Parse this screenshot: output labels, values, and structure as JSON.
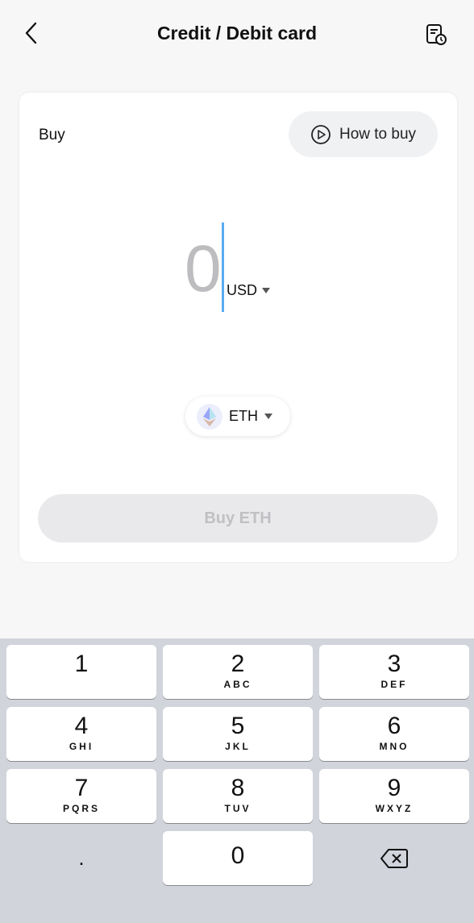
{
  "header": {
    "title": "Credit / Debit card",
    "back_icon": "chevron-left-icon",
    "history_icon": "order-history-icon"
  },
  "card": {
    "buy_label": "Buy",
    "how_to_buy": "How to buy",
    "amount": "0",
    "currency": "USD",
    "asset": "ETH",
    "buy_button": "Buy ETH"
  },
  "colors": {
    "caret": "#5aabf0",
    "keyboard_bg": "#d1d4db"
  },
  "keyboard": {
    "keys": [
      {
        "n": "1",
        "l": ""
      },
      {
        "n": "2",
        "l": "ABC"
      },
      {
        "n": "3",
        "l": "DEF"
      },
      {
        "n": "4",
        "l": "GHI"
      },
      {
        "n": "5",
        "l": "JKL"
      },
      {
        "n": "6",
        "l": "MNO"
      },
      {
        "n": "7",
        "l": "PQRS"
      },
      {
        "n": "8",
        "l": "TUV"
      },
      {
        "n": "9",
        "l": "WXYZ"
      }
    ],
    "decimal": ".",
    "zero": "0"
  }
}
